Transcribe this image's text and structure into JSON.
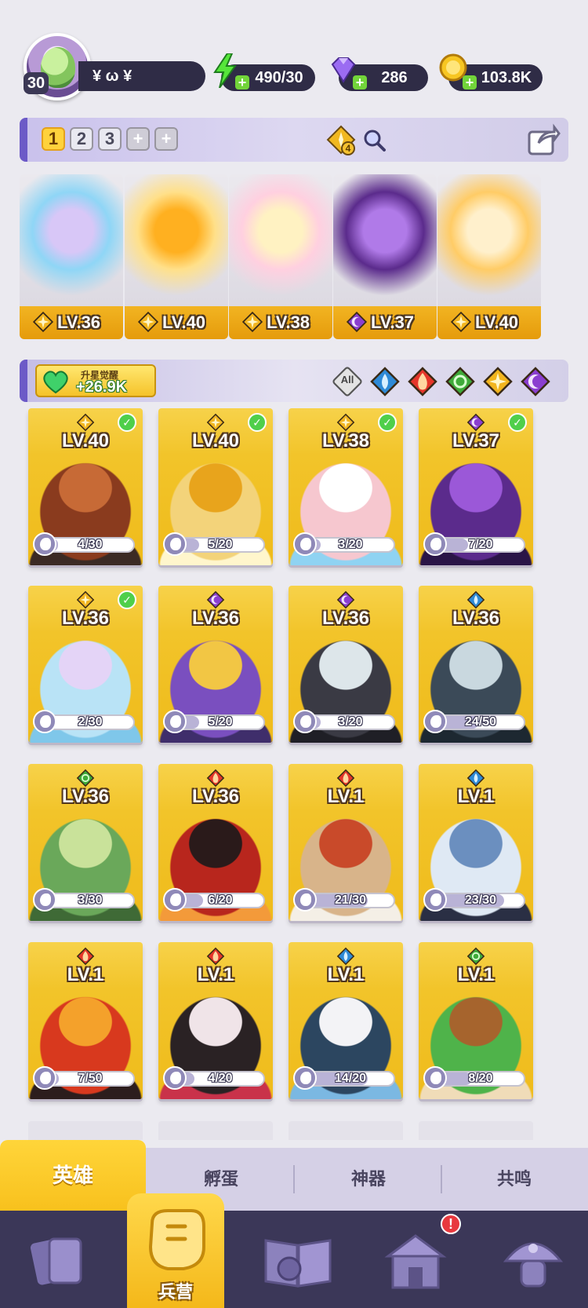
{
  "player": {
    "level": "30",
    "name": "¥ ω ¥"
  },
  "resources": {
    "energy": "490/30",
    "gems": "286",
    "coins": "103.8K"
  },
  "team_tabs": [
    "1",
    "2",
    "3",
    "+",
    "+"
  ],
  "team_tab_badge": "4",
  "team": [
    {
      "level": "LV.36",
      "element": "light",
      "art": "jellyfish"
    },
    {
      "level": "LV.40",
      "element": "light",
      "art": "golden-knight"
    },
    {
      "level": "LV.38",
      "element": "light",
      "art": "angel"
    },
    {
      "level": "LV.37",
      "element": "dark",
      "art": "shadow-siren"
    },
    {
      "level": "LV.40",
      "element": "light",
      "art": "spartan"
    }
  ],
  "awaken": {
    "label": "升星觉醒",
    "value": "+26.9K"
  },
  "filters": [
    {
      "name": "all",
      "label": "All"
    },
    {
      "name": "water",
      "color": "#2f8fd8"
    },
    {
      "name": "fire",
      "color": "#e5382a"
    },
    {
      "name": "nature",
      "color": "#3da83a"
    },
    {
      "name": "light",
      "color": "#f1b820"
    },
    {
      "name": "dark",
      "color": "#8a3fd1"
    }
  ],
  "heroes": [
    {
      "level": "LV.40",
      "element": "light",
      "checked": true,
      "shards": "4/30",
      "progress": 0.13,
      "palette": [
        "#8a3b1e",
        "#c76a36",
        "#3b2a24"
      ]
    },
    {
      "level": "LV.40",
      "element": "light",
      "checked": true,
      "shards": "5/20",
      "progress": 0.25,
      "palette": [
        "#f3d37a",
        "#e8a41c",
        "#fff6cc"
      ]
    },
    {
      "level": "LV.38",
      "element": "light",
      "checked": true,
      "shards": "3/20",
      "progress": 0.15,
      "palette": [
        "#f6c7cf",
        "#ffffff",
        "#8fd3f2"
      ]
    },
    {
      "level": "LV.37",
      "element": "dark",
      "checked": true,
      "shards": "7/20",
      "progress": 0.35,
      "palette": [
        "#5b2b8c",
        "#9b58d8",
        "#2a1547"
      ]
    },
    {
      "level": "LV.36",
      "element": "light",
      "checked": true,
      "shards": "2/30",
      "progress": 0.07,
      "palette": [
        "#b9e3f6",
        "#e4d4f7",
        "#7fc7ea"
      ]
    },
    {
      "level": "LV.36",
      "element": "dark",
      "checked": false,
      "shards": "5/20",
      "progress": 0.25,
      "palette": [
        "#7a4fbf",
        "#f2c644",
        "#3f2e6b"
      ]
    },
    {
      "level": "LV.36",
      "element": "dark",
      "checked": false,
      "shards": "3/20",
      "progress": 0.15,
      "palette": [
        "#3a3a44",
        "#dde6ea",
        "#1f1f26"
      ]
    },
    {
      "level": "LV.36",
      "element": "water",
      "checked": false,
      "shards": "24/50",
      "progress": 0.48,
      "palette": [
        "#3b4a58",
        "#c9d8df",
        "#1d2831"
      ]
    },
    {
      "level": "LV.36",
      "element": "nature",
      "checked": false,
      "shards": "3/30",
      "progress": 0.1,
      "palette": [
        "#6aa85a",
        "#c9e29a",
        "#3f6a36"
      ]
    },
    {
      "level": "LV.36",
      "element": "fire",
      "checked": false,
      "shards": "6/20",
      "progress": 0.3,
      "palette": [
        "#b8261d",
        "#2a1a1a",
        "#f39a3a"
      ]
    },
    {
      "level": "LV.1",
      "element": "fire",
      "checked": false,
      "shards": "21/30",
      "progress": 0.7,
      "palette": [
        "#d8b48a",
        "#c94a2a",
        "#f4efe6"
      ]
    },
    {
      "level": "LV.1",
      "element": "water",
      "checked": false,
      "shards": "23/30",
      "progress": 0.77,
      "palette": [
        "#dfe9f4",
        "#6b8fbf",
        "#2a2f44"
      ]
    },
    {
      "level": "LV.1",
      "element": "fire",
      "checked": false,
      "shards": "7/50",
      "progress": 0.14,
      "palette": [
        "#d8391e",
        "#f4a12b",
        "#2c1d1d"
      ]
    },
    {
      "level": "LV.1",
      "element": "fire",
      "checked": false,
      "shards": "4/20",
      "progress": 0.2,
      "palette": [
        "#2a2224",
        "#f0e4e8",
        "#c9324a"
      ]
    },
    {
      "level": "LV.1",
      "element": "water",
      "checked": false,
      "shards": "14/20",
      "progress": 0.7,
      "palette": [
        "#2c4660",
        "#f3f3f6",
        "#7bb8e2"
      ]
    },
    {
      "level": "LV.1",
      "element": "nature",
      "checked": false,
      "shards": "8/20",
      "progress": 0.4,
      "palette": [
        "#4fb34a",
        "#a6642d",
        "#f0dcb8"
      ]
    }
  ],
  "sub_tabs": [
    "英雄",
    "孵蛋",
    "神器",
    "共鸣"
  ],
  "bottom_nav": {
    "active_label": "兵营",
    "alert": "!"
  },
  "colors": {
    "light": "#f2b51e",
    "dark": "#8b3fd0",
    "water": "#2e8ad6",
    "fire": "#e5362a",
    "nature": "#3fab3a",
    "accent": "#6c5ac7"
  }
}
